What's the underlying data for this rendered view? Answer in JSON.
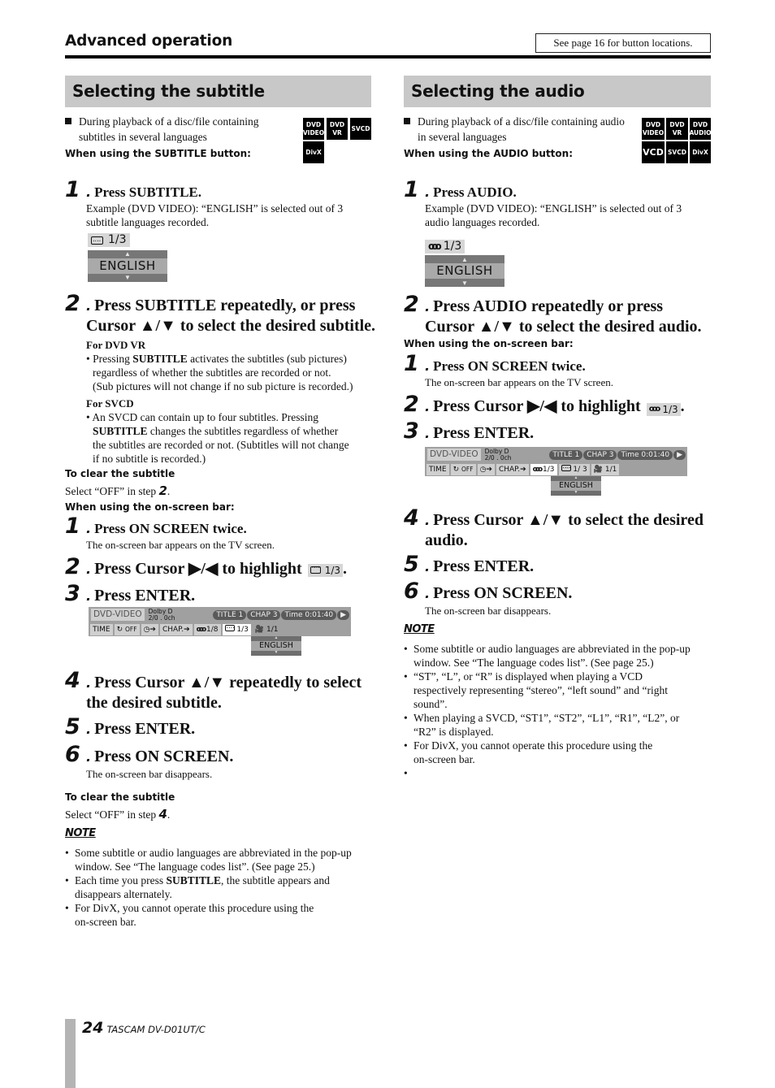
{
  "header": {
    "section": "Advanced operation",
    "reference": "See page 16 for button locations."
  },
  "subtitle": {
    "title": "Selecting the subtitle",
    "condition": "During playback of a disc/file containing subtitles in several languages",
    "condition_line1": "During playback of a disc/file containing",
    "condition_line2": "subtitles in several languages",
    "button_heading": "When using the SUBTITLE button:",
    "formats": [
      "DVD VIDEO",
      "DVD VR",
      "SVCD",
      "DivX"
    ],
    "steps_button": [
      {
        "num": "1",
        "text": "Press SUBTITLE.",
        "desc_line1": "Example (DVD VIDEO): “ENGLISH” is selected out of 3",
        "desc_line2": "subtitle languages recorded."
      },
      {
        "num": "2",
        "text_line1": "Press SUBTITLE repeatedly, or press",
        "text_line2": "Cursor ▲/▼ to select the desired subtitle."
      }
    ],
    "popup": {
      "count": "1/3",
      "language": "ENGLISH"
    },
    "dvdvr": {
      "heading": "For DVD VR",
      "pre": "Pressing ",
      "bold": "SUBTITLE",
      "post1": " activates the subtitles (sub pictures)",
      "line2": "regardless of whether the subtitles are recorded or not.",
      "line3": "(Sub pictures will not change if no sub picture is recorded.)"
    },
    "svcd": {
      "heading": "For SVCD",
      "line1": "An SVCD can contain up to four subtitles. Pressing",
      "bold": "SUBTITLE",
      "line2_post": " changes the subtitles regardless of whether",
      "line3": "the subtitles are recorded or not. (Subtitles will not change",
      "line4": "if no subtitle is recorded.)"
    },
    "clear1": {
      "heading": "To clear the subtitle",
      "text": "Select “OFF” in step ",
      "step": "2",
      "end": "."
    },
    "onscreen_heading": "When using the on-screen bar:",
    "steps_onscreen": [
      {
        "num": "1",
        "text": "Press ON SCREEN twice.",
        "desc": "The on-screen bar appears on the TV screen."
      },
      {
        "num": "2",
        "text": "Press Cursor ▶/◀ to highlight",
        "chip": "1/3",
        "end": "."
      },
      {
        "num": "3",
        "text": "Press ENTER."
      },
      {
        "num": "4",
        "text_line1": "Press Cursor ▲/▼ repeatedly to select",
        "text_line2": "the desired subtitle."
      },
      {
        "num": "5",
        "text": "Press ENTER."
      },
      {
        "num": "6",
        "text": "Press ON SCREEN.",
        "desc": "The on-screen bar disappears."
      }
    ],
    "osb": {
      "disc": "DVD-VIDEO",
      "dolby1": "Dolby D",
      "dolby2": "2/0 . 0ch",
      "title": "TITLE  1",
      "chap": "CHAP  3",
      "time": "Time   0:01:40",
      "time_label": "TIME",
      "repeat": "OFF",
      "chap_jump": "CHAP.➔",
      "audio": "1/8",
      "subtitle": "1/3",
      "angle": "1/1",
      "popup_lang": "ENGLISH"
    },
    "clear2": {
      "heading": "To clear the subtitle",
      "text": "Select “OFF” in step ",
      "step": "4",
      "end": "."
    },
    "note_title": "NOTE",
    "notes": [
      {
        "line1": "Some subtitle or audio languages are abbreviated in the pop-up",
        "line2": "window. See “The language codes list”. (See page 25.)"
      },
      {
        "pre": "Each time you press ",
        "bold": "SUBTITLE",
        "post": ", the subtitle appears and",
        "line2": "disappears alternately."
      },
      {
        "line1": "For DivX, you cannot operate this procedure using the",
        "line2": "on-screen bar."
      }
    ]
  },
  "audio": {
    "title": "Selecting the audio",
    "condition_line1": "During playback of a disc/file containing audio",
    "condition_line2": "in several languages",
    "button_heading": "When using the AUDIO button:",
    "formats": [
      "DVD VIDEO",
      "DVD VR",
      "DVD AUDIO",
      "VCD",
      "SVCD",
      "DivX"
    ],
    "steps_button": [
      {
        "num": "1",
        "text": "Press AUDIO.",
        "desc_line1": "Example (DVD VIDEO): “ENGLISH” is selected out of 3",
        "desc_line2": "audio languages recorded."
      },
      {
        "num": "2",
        "text_line1": "Press AUDIO repeatedly or press",
        "text_line2": "Cursor ▲/▼ to select the desired audio."
      }
    ],
    "popup": {
      "count": "1/3",
      "language": "ENGLISH"
    },
    "onscreen_heading": "When using the on-screen bar:",
    "steps_onscreen": [
      {
        "num": "1",
        "text": "Press ON SCREEN twice.",
        "desc": "The on-screen bar appears on the TV screen."
      },
      {
        "num": "2",
        "text": "Press Cursor ▶/◀ to highlight",
        "chip": "1/3",
        "end": "."
      },
      {
        "num": "3",
        "text": "Press ENTER."
      },
      {
        "num": "4",
        "text_line1": "Press Cursor ▲/▼ to select the desired",
        "text_line2": "audio."
      },
      {
        "num": "5",
        "text": "Press ENTER."
      },
      {
        "num": "6",
        "text": "Press ON SCREEN.",
        "desc": "The on-screen bar disappears."
      }
    ],
    "osb": {
      "disc": "DVD-VIDEO",
      "dolby1": "Dolby D",
      "dolby2": "2/0 . 0ch",
      "title": "TITLE  1",
      "chap": "CHAP  3",
      "time": "Time   0:01:40",
      "time_label": "TIME",
      "repeat": "OFF",
      "chap_jump": "CHAP.➔",
      "audio": "1/3",
      "subtitle": "1/ 3",
      "angle": "1/1",
      "popup_lang": "ENGLISH"
    },
    "note_title": "NOTE",
    "notes": [
      {
        "line1": "Some subtitle or audio languages are abbreviated in the pop-up",
        "line2": "window. See “The language codes list”. (See page 25.)"
      },
      {
        "line1": "“ST”, “L”, or “R” is displayed when playing a VCD",
        "line2": "respectively representing “stereo”, “left sound” and “right",
        "line3": "sound”."
      },
      {
        "line1": "When playing a SVCD, “ST1”, “ST2”, “L1”, “R1”, “L2”, or",
        "line2": "“R2” is displayed."
      },
      {
        "line1": "For DivX, you cannot operate this procedure using the",
        "line2": "on-screen bar."
      },
      {
        "line1": ""
      }
    ]
  },
  "footer": {
    "page": "24",
    "model": "TASCAM  DV-D01UT/C"
  }
}
